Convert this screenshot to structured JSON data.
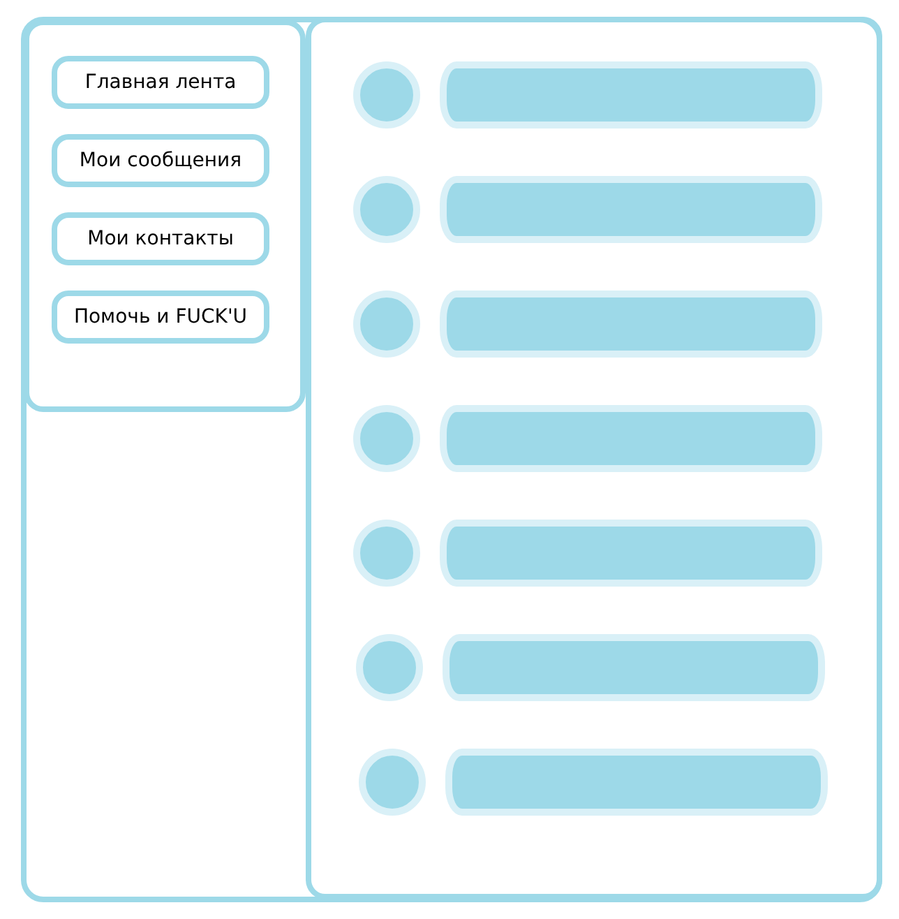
{
  "sidebar": {
    "items": [
      {
        "label": "Главная лента"
      },
      {
        "label": "Мои сообщения"
      },
      {
        "label": "Мои контакты"
      },
      {
        "label": "Помочь и FUCK'U"
      }
    ]
  },
  "feed": {
    "items": [
      {
        "kind": "placeholder"
      },
      {
        "kind": "placeholder"
      },
      {
        "kind": "placeholder"
      },
      {
        "kind": "placeholder"
      },
      {
        "kind": "placeholder"
      },
      {
        "kind": "placeholder"
      },
      {
        "kind": "placeholder"
      }
    ]
  }
}
